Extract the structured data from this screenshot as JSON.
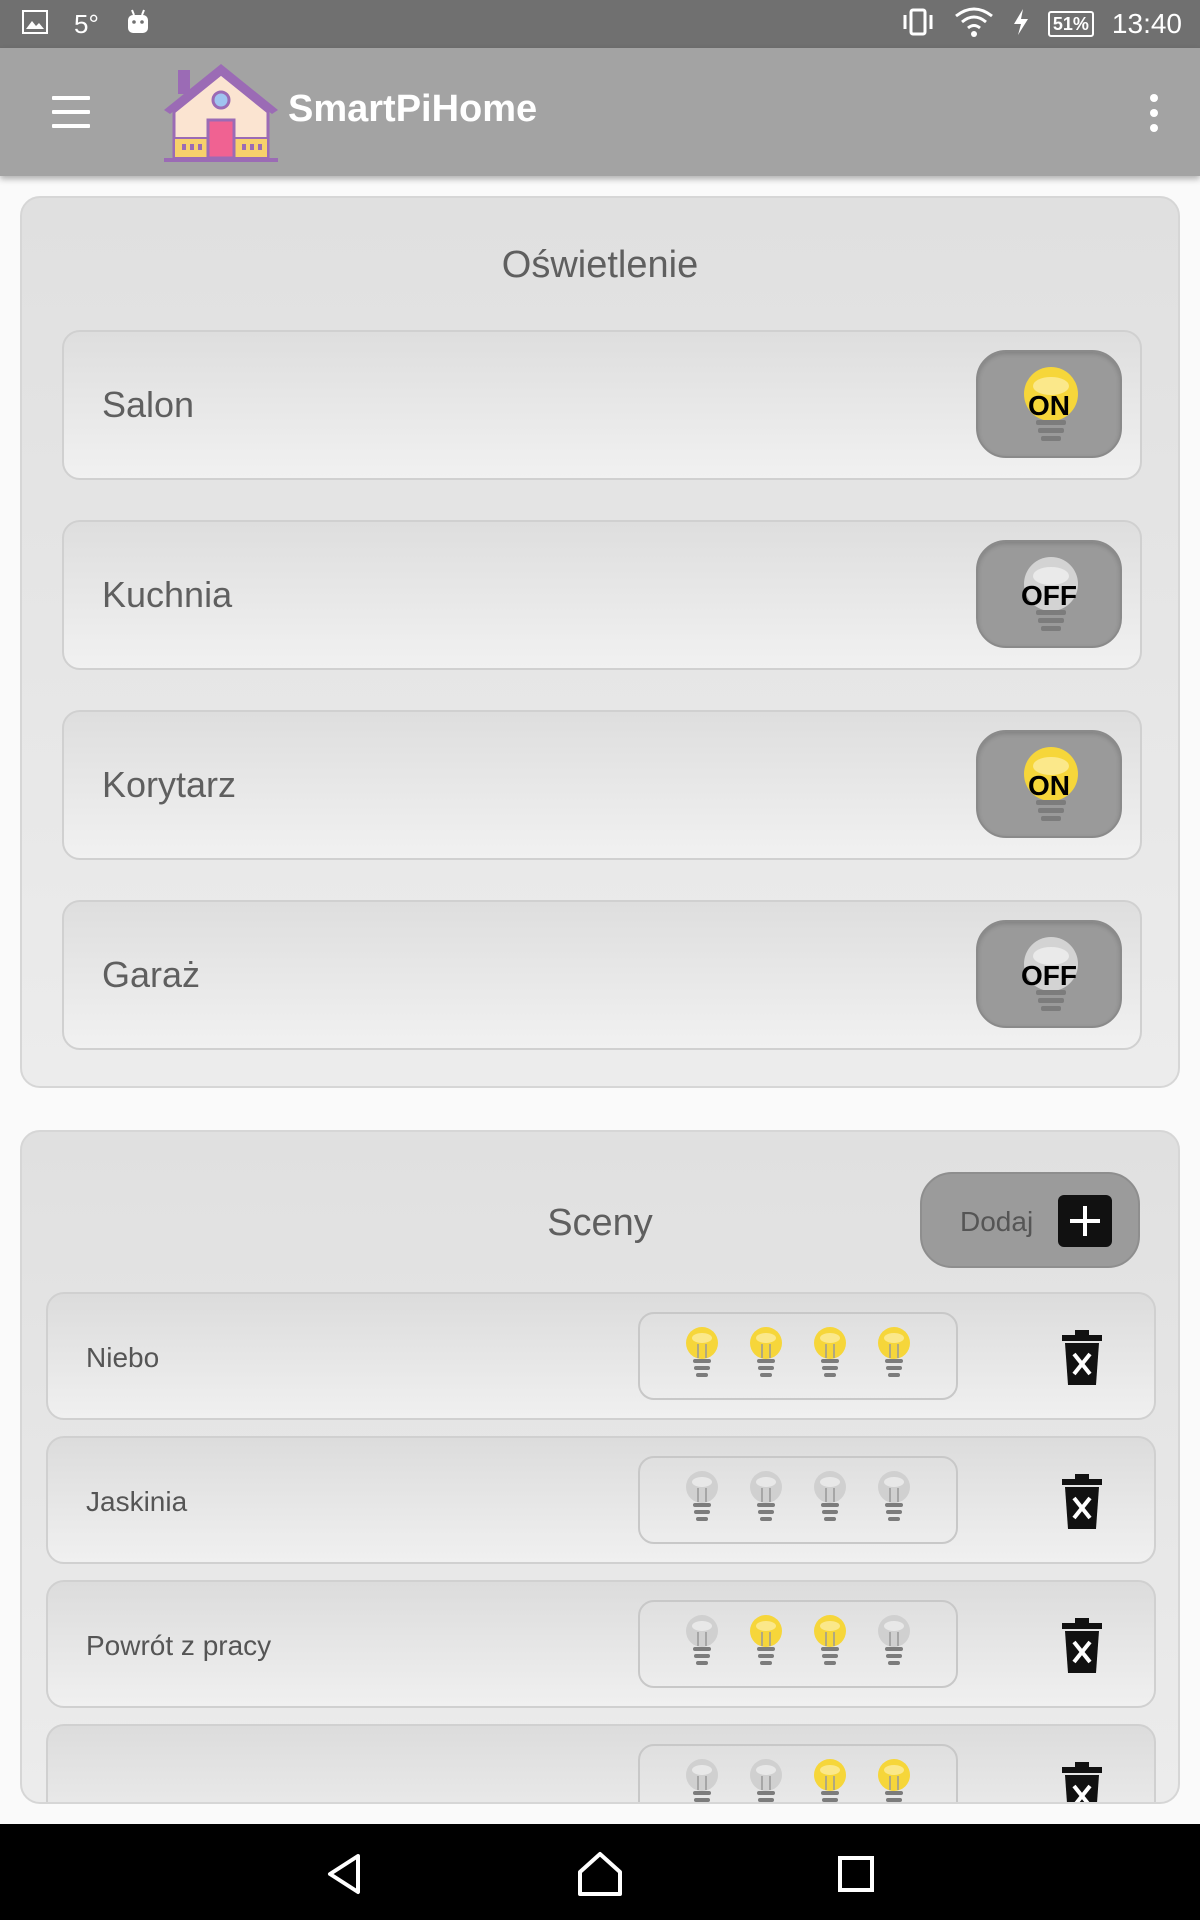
{
  "status_bar": {
    "temperature": "5°",
    "battery": "51%",
    "time": "13:40",
    "icons": [
      "gallery-icon",
      "android-icon",
      "vibrate-icon",
      "wifi-icon",
      "charging-icon",
      "battery-icon"
    ]
  },
  "app_bar": {
    "title": "SmartPiHome",
    "icons": [
      "menu-icon",
      "house-logo-icon",
      "more-vert-icon"
    ]
  },
  "lighting": {
    "title": "Oświetlenie",
    "items": [
      {
        "name": "Salon",
        "state": "ON"
      },
      {
        "name": "Kuchnia",
        "state": "OFF"
      },
      {
        "name": "Korytarz",
        "state": "ON"
      },
      {
        "name": "Garaż",
        "state": "OFF"
      }
    ]
  },
  "scenes": {
    "title": "Sceny",
    "add_label": "Dodaj",
    "items": [
      {
        "name": "Niebo",
        "bulbs": [
          true,
          true,
          true,
          true
        ]
      },
      {
        "name": "Jaskinia",
        "bulbs": [
          false,
          false,
          false,
          false
        ]
      },
      {
        "name": "Powrót z pracy",
        "bulbs": [
          false,
          true,
          true,
          false
        ]
      },
      {
        "name": "",
        "bulbs": [
          false,
          false,
          true,
          true
        ]
      }
    ]
  },
  "colors": {
    "status_bar": "#707070",
    "app_bar": "#a3a3a3",
    "bulb_on": "#f6d63a",
    "bulb_off": "#d0d0d0",
    "toggle_bg": "#9a9a9a"
  }
}
